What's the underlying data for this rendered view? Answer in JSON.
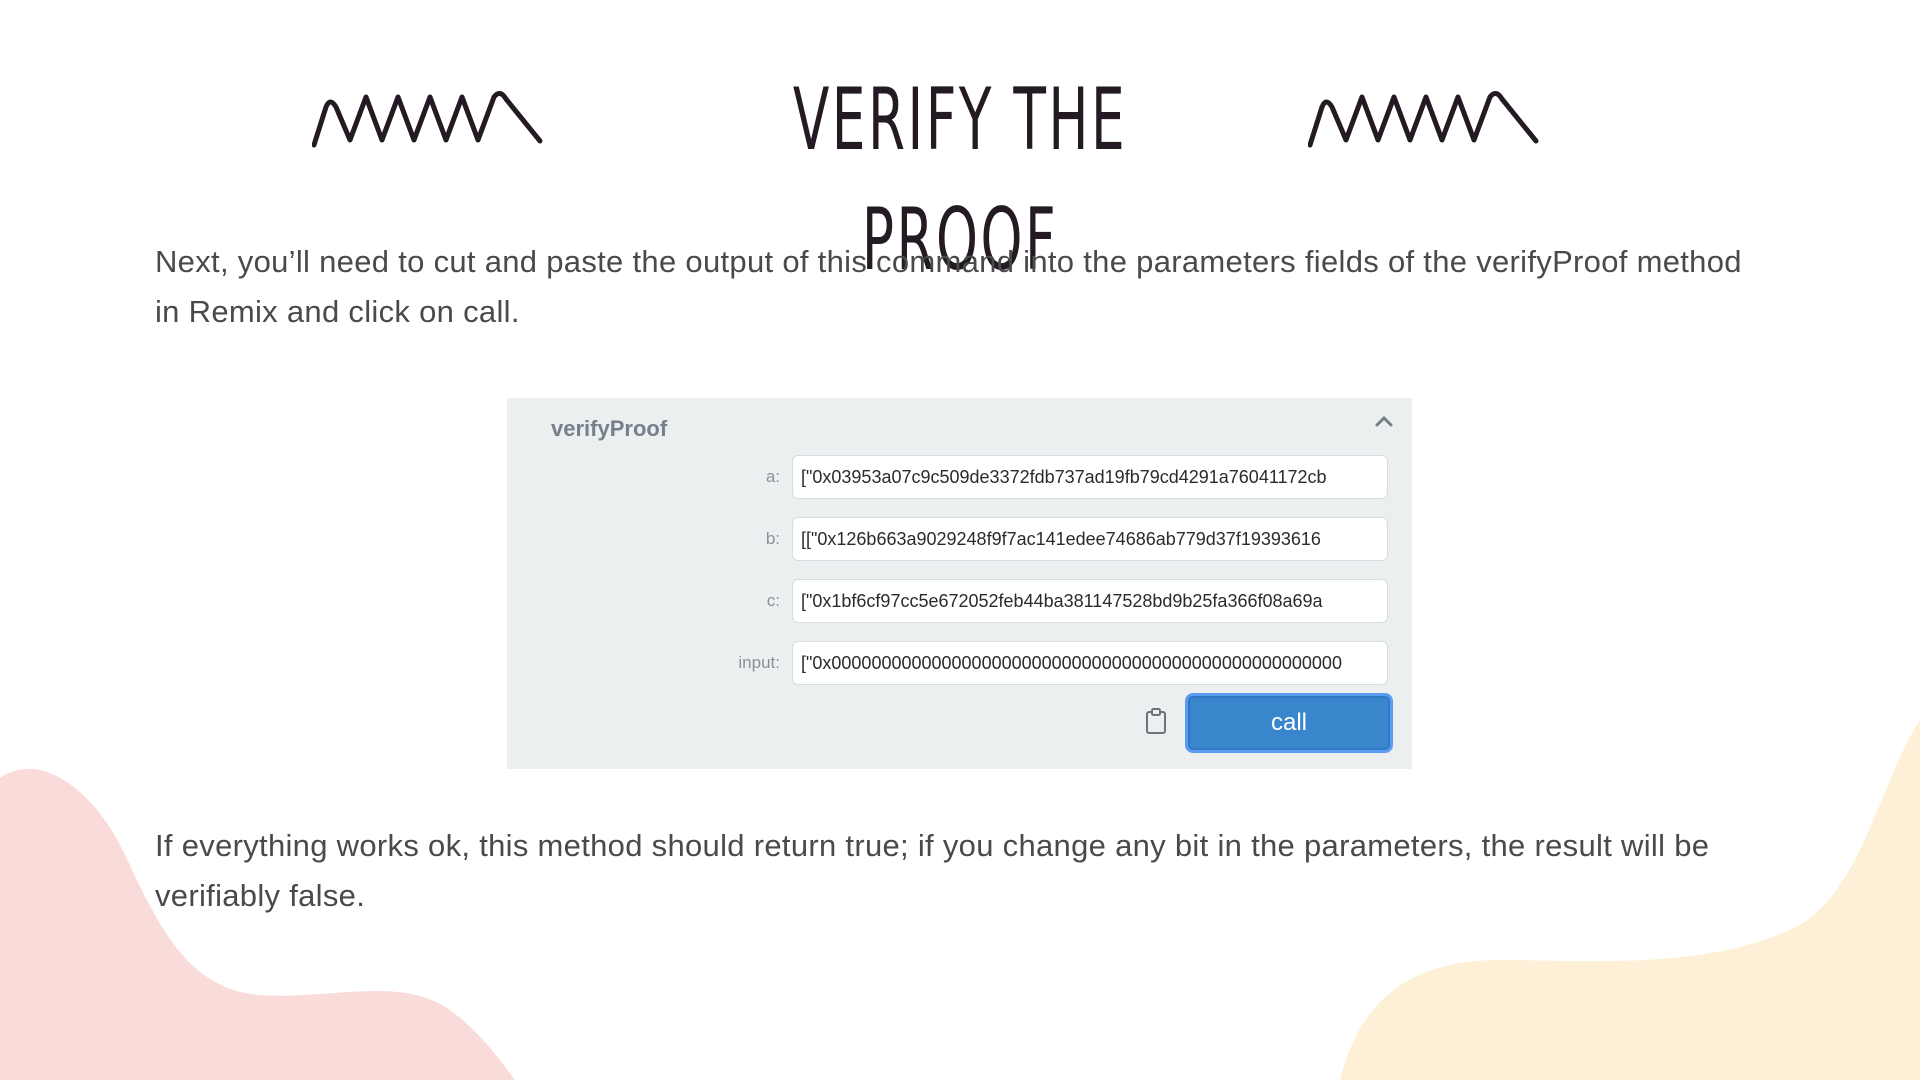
{
  "slide": {
    "title": "VERIFY THE PROOF",
    "paragraph_1": "Next, you’ll need to cut and paste the output of this command into the parameters fields of the verifyProof method in Remix and click on call.",
    "paragraph_2": "If everything works ok, this method should return true; if you change any bit in the parameters, the result will be verifiably false."
  },
  "panel": {
    "title": "verifyProof",
    "params": [
      {
        "label": "a:",
        "value": "[\"0x03953a07c9c509de3372fdb737ad19fb79cd4291a76041172cb"
      },
      {
        "label": "b:",
        "value": "[[\"0x126b663a9029248f9f7ac141edee74686ab779d37f19393616"
      },
      {
        "label": "c:",
        "value": "[\"0x1bf6cf97cc5e672052feb44ba381147528bd9b25fa366f08a69a"
      },
      {
        "label": "input:",
        "value": "[\"0x000000000000000000000000000000000000000000000000000"
      }
    ],
    "call_label": "call"
  },
  "colors": {
    "title": "#231a24",
    "text": "#4a4a4a",
    "panel_bg": "#ebeff0",
    "call_button": "#3a86cd",
    "blob_pink": "#f9dcd9",
    "blob_yellow": "#fdf0d6"
  },
  "icons": {
    "collapse": "chevron-up-icon",
    "clipboard": "clipboard-icon",
    "squiggle": "squiggle-icon"
  }
}
